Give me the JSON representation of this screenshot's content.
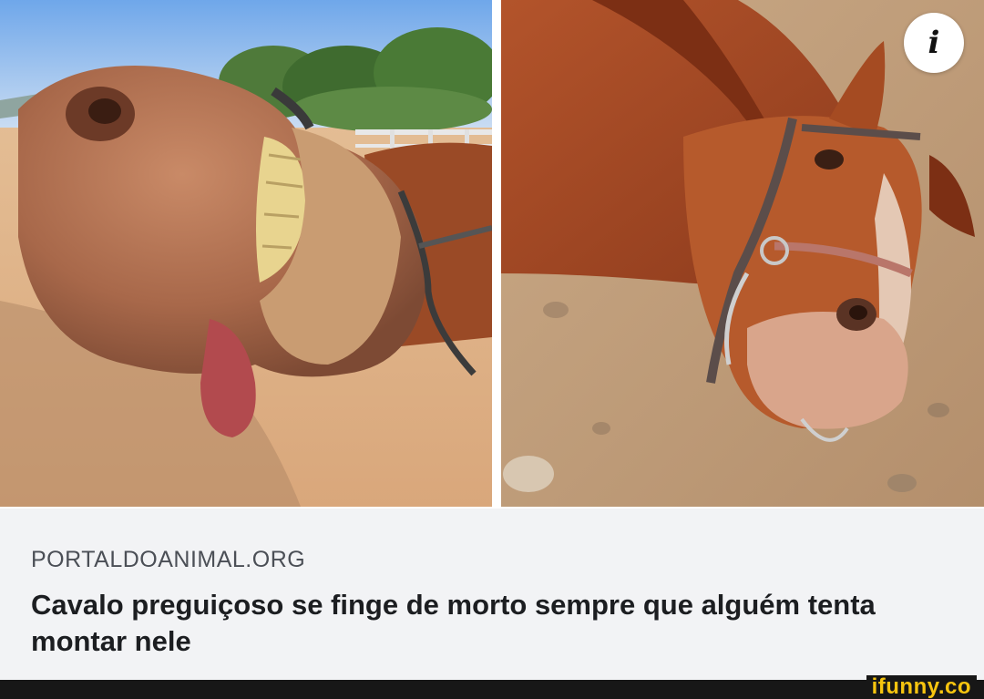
{
  "post": {
    "images": [
      {
        "subject": "smiling horse close-up"
      },
      {
        "subject": "horse lying on dirt ground"
      }
    ],
    "info_icon": "info-icon",
    "info_glyph": "i"
  },
  "link_preview": {
    "domain": "PORTALDOANIMAL.ORG",
    "title": "Cavalo preguiçoso se finge de morto sempre que alguém tenta montar nele"
  },
  "watermark": {
    "text": "ifunny.co",
    "color": "#f6c40f"
  },
  "colors": {
    "card_background": "#f2f3f5",
    "title_text": "#1c1e21",
    "domain_text": "#4b4f56"
  }
}
